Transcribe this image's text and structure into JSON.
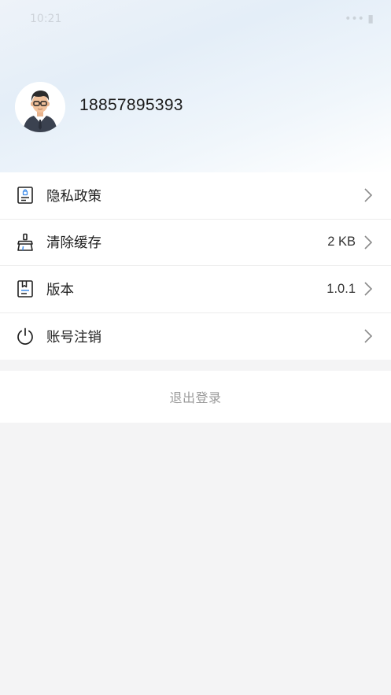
{
  "status_bar": {
    "time": "10:21",
    "right": "•••  ▮"
  },
  "profile": {
    "phone": "18857895393"
  },
  "menu": {
    "items": [
      {
        "label": "隐私政策",
        "value": "",
        "icon": "privacy-policy-icon"
      },
      {
        "label": "清除缓存",
        "value": "2 KB",
        "icon": "broom-icon"
      },
      {
        "label": "版本",
        "value": "1.0.1",
        "icon": "version-book-icon"
      },
      {
        "label": "账号注销",
        "value": "",
        "icon": "power-icon"
      }
    ]
  },
  "logout": {
    "label": "退出登录"
  },
  "colors": {
    "header_gradient": "#e4eef8",
    "background": "#f4f4f5",
    "logout_text": "#9a9a9a"
  }
}
